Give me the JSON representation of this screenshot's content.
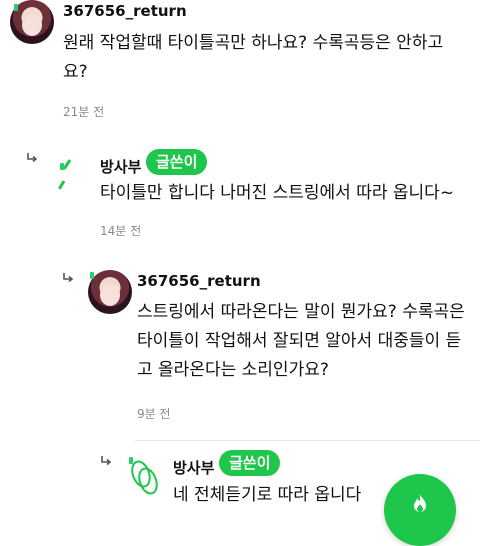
{
  "comments": [
    {
      "nickname": "367656_return",
      "text": "원래 작업할때 타이틀곡만 하나요? 수록곡등은 안하고 요?",
      "time": "21분 전"
    },
    {
      "nickname": "방사부",
      "badge": "글쓴이",
      "text": "타이틀만 합니다 나머진 스트링에서 따라 옵니다~",
      "time": "14분 전"
    },
    {
      "nickname": "367656_return",
      "text": "스트링에서 따라온다는 말이 뭔가요? 수록곡은 타이틀이 작업해서 잘되면 알아서 대중들이 듣고 올라온다는 소리인가요?",
      "time": "9분 전"
    },
    {
      "nickname": "방사부",
      "badge": "글쓴이",
      "text": "네 전체듣기로 따라 옵니다"
    }
  ],
  "icons": {
    "reply": "reply-arrow-icon",
    "fab": "flame-icon"
  },
  "colors": {
    "badge": "#1ec64c",
    "time": "#8a8a8a"
  }
}
